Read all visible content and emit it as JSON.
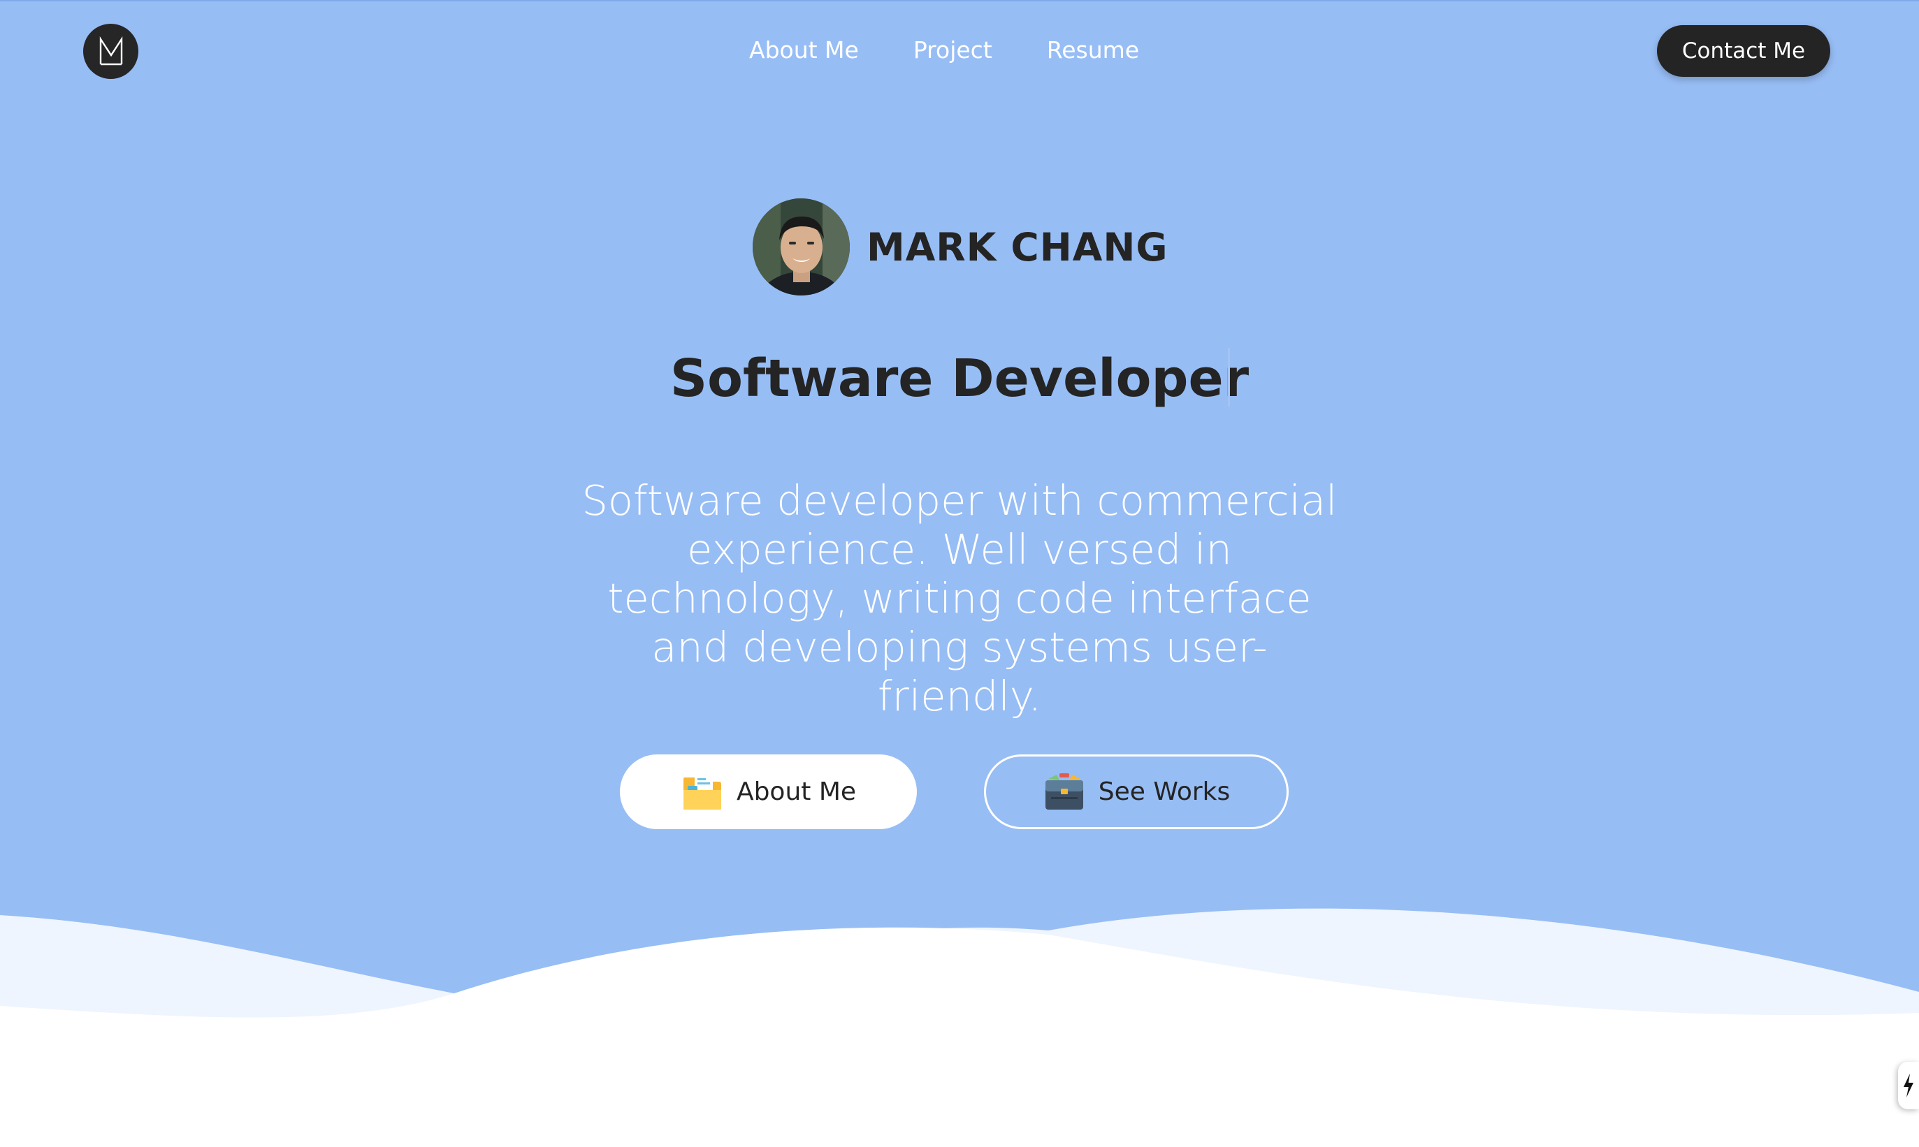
{
  "brand": {
    "logo_letter": "M"
  },
  "nav": {
    "links": [
      {
        "label": "About Me"
      },
      {
        "label": "Project"
      },
      {
        "label": "Resume"
      }
    ],
    "contact_label": "Contact Me"
  },
  "profile": {
    "name": "MARK CHANG",
    "title": "Software Developer",
    "description": "Software developer with commercial experience. Well versed in technology, writing code interface and developing systems user-friendly."
  },
  "actions": {
    "about_label": "About Me",
    "works_label": "See Works"
  },
  "colors": {
    "hero_bg": "#97bdf5",
    "dark": "#242424",
    "white": "#ffffff",
    "wave_light": "#eef5fe"
  },
  "icons": {
    "logo": "m-monogram-logo",
    "about_button": "folder-icon",
    "works_button": "briefcase-icon",
    "corner": "lightning-icon"
  }
}
